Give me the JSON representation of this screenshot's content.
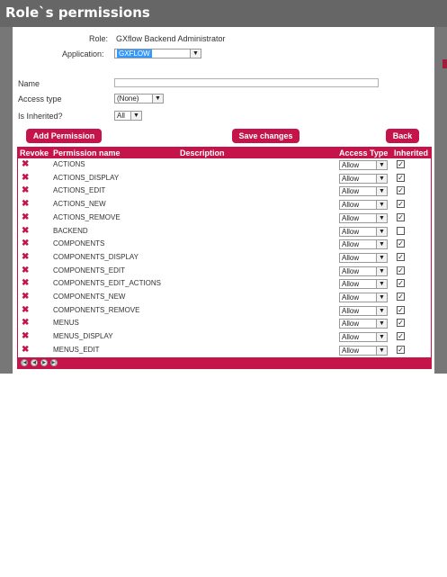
{
  "window": {
    "title": "Role`s permissions"
  },
  "form": {
    "role_label": "Role:",
    "role_value": "GXflow Backend Administrator",
    "application_label": "Application:",
    "application_value": "GXFLOW",
    "name_label": "Name",
    "name_value": "",
    "access_type_label": "Access type",
    "access_type_value": "(None)",
    "is_inherited_label": "Is Inherited?",
    "is_inherited_value": "All"
  },
  "buttons": {
    "add_permission": "Add Permission",
    "save_changes": "Save changes",
    "back": "Back"
  },
  "grid": {
    "headers": {
      "revoke": "Revoke",
      "permission_name": "Permission name",
      "description": "Description",
      "access_type": "Access Type",
      "inherited": "Inherited"
    },
    "rows": [
      {
        "name": "ACTIONS",
        "access": "Allow",
        "inherited": true
      },
      {
        "name": "ACTIONS_DISPLAY",
        "access": "Allow",
        "inherited": true
      },
      {
        "name": "ACTIONS_EDIT",
        "access": "Allow",
        "inherited": true
      },
      {
        "name": "ACTIONS_NEW",
        "access": "Allow",
        "inherited": true
      },
      {
        "name": "ACTIONS_REMOVE",
        "access": "Allow",
        "inherited": true
      },
      {
        "name": "BACKEND",
        "access": "Allow",
        "inherited": false
      },
      {
        "name": "COMPONENTS",
        "access": "Allow",
        "inherited": true
      },
      {
        "name": "COMPONENTS_DISPLAY",
        "access": "Allow",
        "inherited": true
      },
      {
        "name": "COMPONENTS_EDIT",
        "access": "Allow",
        "inherited": true
      },
      {
        "name": "COMPONENTS_EDIT_ACTIONS",
        "access": "Allow",
        "inherited": true
      },
      {
        "name": "COMPONENTS_NEW",
        "access": "Allow",
        "inherited": true
      },
      {
        "name": "COMPONENTS_REMOVE",
        "access": "Allow",
        "inherited": true
      },
      {
        "name": "MENUS",
        "access": "Allow",
        "inherited": true
      },
      {
        "name": "MENUS_DISPLAY",
        "access": "Allow",
        "inherited": true
      },
      {
        "name": "MENUS_EDIT",
        "access": "Allow",
        "inherited": true
      }
    ]
  },
  "pager": {
    "icons": [
      "first-page-icon",
      "prev-page-icon",
      "next-page-icon",
      "last-page-icon"
    ]
  },
  "colors": {
    "accent": "#c4144a",
    "title_bar": "#666666",
    "selection": "#3399ff"
  }
}
